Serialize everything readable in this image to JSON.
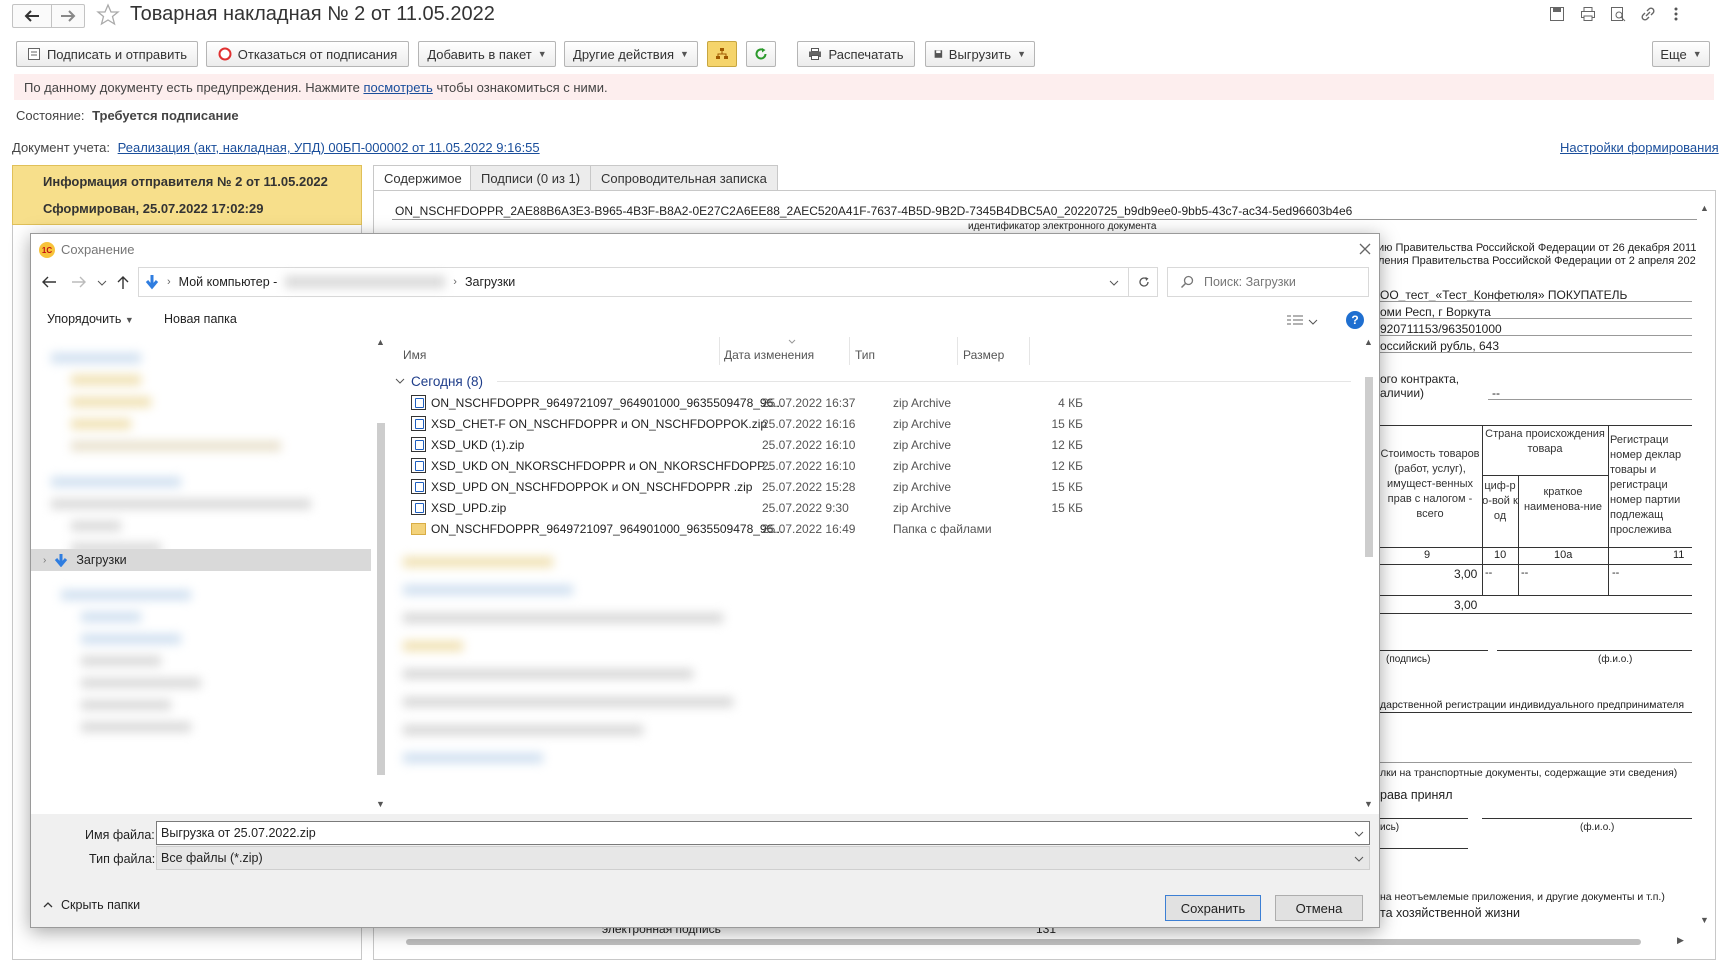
{
  "window": {
    "title": "Товарная накладная № 2 от 11.05.2022"
  },
  "toolbar": {
    "sign_send": "Подписать и отправить",
    "refuse_sign": "Отказаться от подписания",
    "add_to_package": "Добавить в пакет",
    "other_actions": "Другие действия",
    "print": "Распечатать",
    "export": "Выгрузить",
    "more": "Еще"
  },
  "warning": {
    "prefix": "По данному документу есть предупреждения. Нажмите ",
    "link": "посмотреть",
    "suffix": " чтобы ознакомиться с ними."
  },
  "state": {
    "label": "Состояние:",
    "value": "Требуется подписание"
  },
  "account_doc": {
    "label": "Документ учета:",
    "link": "Реализация (акт, накладная, УПД) 00БП-000002 от 11.05.2022 9:16:55",
    "settings_link": "Настройки формирования"
  },
  "left_panel": {
    "info": "Информация отправителя № 2 от 11.05.2022",
    "formed": "Сформирован, 25.07.2022 17:02:29"
  },
  "tabs": [
    {
      "label": "Содержимое"
    },
    {
      "label": "Подписи (0 из 1)"
    },
    {
      "label": "Сопроводительная записка"
    }
  ],
  "doc": {
    "id_value": "ON_NSCHFDOPPR_2AE88B6A3E3-B965-4B3F-B8A2-0E27C2A6EE88_2AEC520A41F-7637-4B5D-9B2D-7345B4DBC5A0_20220725_b9db9ee0-9bb5-43c7-ac34-5ed96603b4e6",
    "id_caption": "идентификатор электронного документа",
    "gov1": "ию Правительства Российской Федерации от 26 декабря 2011",
    "gov2": "ления Правительства Российской Федерации от 2 апреля 202",
    "buyer": "ОО_тест_«Тест_Конфетюля» ПОКУПАТЕЛЬ",
    "address": "оми Респ, г Воркута",
    "inn": "920711153/963501000",
    "currency": "оссийский рубль, 643",
    "contract1": "ого контракта,",
    "contract2": "аличии)",
    "contract_val": "--",
    "col_cost": "Стоимость товаров (работ, услуг), имущест-венных прав с налогом - всего",
    "col_country": "Страна происхождения товара",
    "col_code": "циф-ро-вой код",
    "col_short": "краткое наименова-ние",
    "col_reg": "Регистраци номер деклар товары и регистраци номер партии подлежащ прослежива",
    "n9": "9",
    "n10": "10",
    "n10a": "10а",
    "n11": "11",
    "v300a": "3,00",
    "v300b": "3,00",
    "dash": "--",
    "sign_cap": "(подпись)",
    "fio_cap": "(ф.и.о.)",
    "state_reg": "дарственной регистрации индивидуального предпринимателя",
    "transport": "лки на транспортные документы, содержащие эти сведения)",
    "accepted": "рава принял",
    "sign_cap2": "ись)",
    "fio_cap2": "(ф.и.о.)",
    "annex": "на неотъемлемые приложения, и другие документы и т.п.)",
    "fact": "та хозяйственной жизни",
    "esign": "электронная подпись",
    "num131": "131"
  },
  "dialog": {
    "title": "Сохранение",
    "path_root": "Мой компьютер -",
    "path_folder": "Загрузки",
    "search_placeholder": "Поиск: Загрузки",
    "organize": "Упорядочить",
    "new_folder": "Новая папка",
    "help": "?",
    "nav_downloads": "Загрузки",
    "columns": {
      "name": "Имя",
      "date": "Дата изменения",
      "type": "Тип",
      "size": "Размер"
    },
    "group": "Сегодня (8)",
    "files": [
      {
        "name": "ON_NSCHFDOPPR_9649721097_964901000_9635509478_96...",
        "date": "25.07.2022 16:37",
        "type": "zip Archive",
        "size": "4 КБ",
        "kind": "zip"
      },
      {
        "name": "XSD_CHET-F ON_NSCHFDOPPR и ON_NSCHFDOPPOK.zip",
        "date": "25.07.2022 16:16",
        "type": "zip Archive",
        "size": "15 КБ",
        "kind": "zip"
      },
      {
        "name": "XSD_UKD (1).zip",
        "date": "25.07.2022 16:10",
        "type": "zip Archive",
        "size": "12 КБ",
        "kind": "zip"
      },
      {
        "name": "XSD_UKD ON_NKORSCHFDOPPR и ON_NKORSCHFDOPP...",
        "date": "25.07.2022 16:10",
        "type": "zip Archive",
        "size": "12 КБ",
        "kind": "zip"
      },
      {
        "name": "XSD_UPD ON_NSCHFDOPPOK и ON_NSCHFDOPPR .zip",
        "date": "25.07.2022 15:28",
        "type": "zip Archive",
        "size": "15 КБ",
        "kind": "zip"
      },
      {
        "name": "XSD_UPD.zip",
        "date": "25.07.2022 9:30",
        "type": "zip Archive",
        "size": "15 КБ",
        "kind": "zip"
      },
      {
        "name": "ON_NSCHFDOPPR_9649721097_964901000_9635509478_96...",
        "date": "25.07.2022 16:49",
        "type": "Папка с файлами",
        "size": "",
        "kind": "folder"
      }
    ],
    "filename_label": "Имя файла:",
    "filename_value": "Выгрузка от 25.07.2022.zip",
    "filetype_label": "Тип файла:",
    "filetype_value": "Все файлы (*.zip)",
    "hide_folders": "Скрыть папки",
    "save": "Сохранить",
    "cancel": "Отмена"
  },
  "colors": {
    "accent": "#f5d46b",
    "warning_bg": "#fdeeee",
    "link": "#1a4e9b",
    "selection": "#cde8ff"
  }
}
